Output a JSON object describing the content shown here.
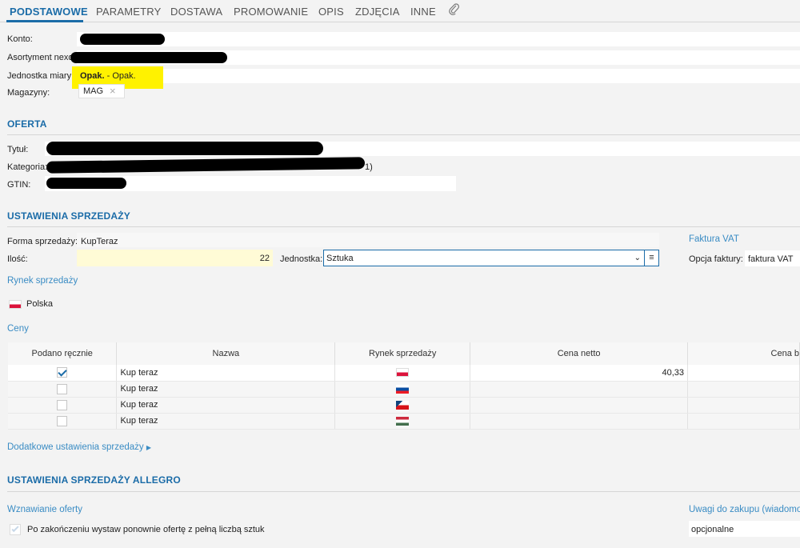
{
  "tabs": [
    {
      "label": "PODSTAWOWE",
      "active": true
    },
    {
      "label": "PARAMETRY"
    },
    {
      "label": "DOSTAWA"
    },
    {
      "label": "PROMOWANIE"
    },
    {
      "label": "OPIS"
    },
    {
      "label": "ZDJĘCIA"
    },
    {
      "label": "INNE"
    }
  ],
  "basic": {
    "konto_label": "Konto:",
    "asortyment_label": "Asortyment nexo:",
    "jednostka_label": "Jednostka miary:",
    "jednostka_value_bold": "Opak.",
    "jednostka_value_rest": " - Opak.",
    "magazyny_label": "Magazyny:",
    "magazyn_tag": "MAG"
  },
  "oferta": {
    "title": "OFERTA",
    "tytul_label": "Tytuł:",
    "kategoria_label": "Kategoria:",
    "kategoria_suffix": "1)",
    "gtin_label": "GTIN:"
  },
  "sprzedaz": {
    "title": "USTAWIENIA SPRZEDAŻY",
    "forma_label": "Forma sprzedaży:",
    "forma_value": "KupTeraz",
    "ilosc_label": "Ilość:",
    "ilosc_value": "22",
    "jednostka_label": "Jednostka:",
    "jednostka_value": "Sztuka",
    "faktura_title": "Faktura VAT",
    "opcja_label": "Opcja faktury:",
    "opcja_value": "faktura VAT",
    "rynek_title": "Rynek sprzedaży",
    "rynek_value": "Polska",
    "ceny_title": "Ceny",
    "dodatkowe_link": "Dodatkowe ustawienia sprzedaży"
  },
  "prices_table": {
    "headers": [
      "Podano ręcznie",
      "Nazwa",
      "Rynek sprzedaży",
      "Cena netto",
      "Cena b"
    ],
    "rows": [
      {
        "checked": true,
        "name": "Kup teraz",
        "flag": "flag-pl-icon",
        "netto": "40,33"
      },
      {
        "checked": false,
        "name": "Kup teraz",
        "flag": "flag-sk-icon",
        "netto": ""
      },
      {
        "checked": false,
        "name": "Kup teraz",
        "flag": "flag-cz-icon",
        "netto": ""
      },
      {
        "checked": false,
        "name": "Kup teraz",
        "flag": "flag-hu-icon",
        "netto": ""
      }
    ]
  },
  "allegro": {
    "title": "USTAWIENIA SPRZEDAŻY ALLEGRO",
    "wznawianie_title": "Wznawianie oferty",
    "wznawianie_checkbox_label": "Po zakończeniu wystaw ponownie ofertę z pełną liczbą sztuk",
    "uwagi_title": "Uwagi do zakupu (wiadomo",
    "uwagi_value": "opcjonalne"
  },
  "colors": {
    "accent": "#1b6ca8",
    "highlight": "#fff200",
    "qty_bg": "#fffbd6"
  }
}
